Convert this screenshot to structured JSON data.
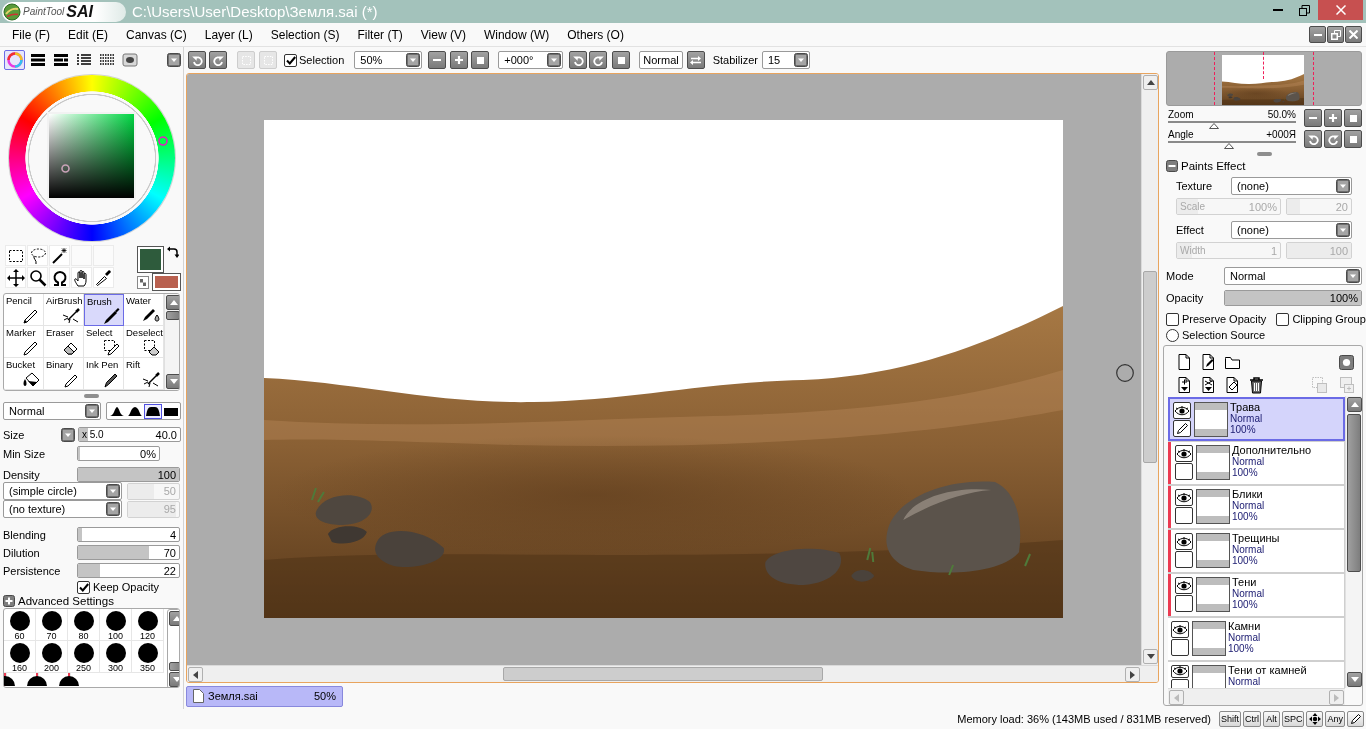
{
  "title_bar": {
    "logo_text": "PaintTool",
    "logo_mark": "SAI",
    "title": "C:\\Users\\User\\Desktop\\Земля.sai (*)"
  },
  "menu": [
    "File (F)",
    "Edit (E)",
    "Canvas (C)",
    "Layer (L)",
    "Selection (S)",
    "Filter (T)",
    "View (V)",
    "Window (W)",
    "Others (O)"
  ],
  "color_modes": [
    {
      "selected": true
    },
    {
      "selected": false
    },
    {
      "selected": false
    },
    {
      "selected": false
    },
    {
      "selected": false
    },
    {
      "selected": false
    }
  ],
  "swatches": [
    {
      "color": "#2e5b3c"
    },
    {
      "color": "#b9604f"
    }
  ],
  "tools": [
    {
      "name": "Pencil",
      "selected": false
    },
    {
      "name": "AirBrush",
      "selected": false
    },
    {
      "name": "Brush",
      "selected": true
    },
    {
      "name": "Water",
      "selected": false
    },
    {
      "name": "Marker",
      "selected": false
    },
    {
      "name": "Eraser",
      "selected": false
    },
    {
      "name": "Select",
      "selected": false
    },
    {
      "name": "Deselect",
      "selected": false
    },
    {
      "name": "Bucket",
      "selected": false
    },
    {
      "name": "Binary",
      "selected": false
    },
    {
      "name": "Ink Pen",
      "selected": false
    },
    {
      "name": "Rift",
      "selected": false
    }
  ],
  "brush": {
    "mode": "Normal",
    "shapes": [
      {
        "selected": false
      },
      {
        "selected": false
      },
      {
        "selected": true
      },
      {
        "selected": false
      }
    ],
    "size": {
      "label": "Size",
      "multiplier": "x 5.0",
      "value": "40.0",
      "level": 0.09
    },
    "min_size": {
      "label": "Min Size",
      "value": "0%",
      "level": 0
    },
    "density": {
      "label": "Density",
      "value": "100",
      "level": 1
    },
    "shape": {
      "value": "(simple circle)",
      "strength": "50",
      "level": 0.5,
      "disabled": true
    },
    "texture": {
      "value": "(no texture)",
      "strength": "95",
      "level": 0.95,
      "disabled": true
    },
    "sliders": [
      {
        "label": "Blending",
        "value": "4",
        "level": 0.04
      },
      {
        "label": "Dilution",
        "value": "70",
        "level": 0.7
      },
      {
        "label": "Persistence",
        "value": "22",
        "level": 0.22
      }
    ],
    "keep_opacity": {
      "label": "Keep Opacity",
      "checked": true
    },
    "advanced": {
      "label": "Advanced Settings",
      "expanded": false
    },
    "presets": [
      {
        "label": "60"
      },
      {
        "label": "70"
      },
      {
        "label": "80"
      },
      {
        "label": "100"
      },
      {
        "label": "120"
      },
      {
        "label": "160"
      },
      {
        "label": "200"
      },
      {
        "label": "250"
      },
      {
        "label": "300"
      },
      {
        "label": "350"
      },
      {
        "kind": "clipped"
      },
      {
        "kind": "clipped"
      },
      {
        "kind": "clipped"
      }
    ]
  },
  "canvas_toolbar": {
    "selection_buttons": [
      {
        "disabled": true
      },
      {
        "disabled": true
      }
    ],
    "selection": {
      "label": "Selection",
      "checked": true
    },
    "zoom": "50%",
    "angle": "+000°",
    "mode": "Normal",
    "stabilizer_label": "Stabilizer",
    "stabilizer": "15"
  },
  "document_tabs": [
    {
      "name": "Земля.sai",
      "zoom": "50%",
      "selected": true
    }
  ],
  "navigator": {
    "zoom": {
      "label": "Zoom",
      "value": "50.0%",
      "level": 0.36
    },
    "angle": {
      "label": "Angle",
      "value": "+000Я",
      "level": 0.48
    }
  },
  "paints_effect": {
    "title": "Paints Effect",
    "expanded": true,
    "rows": [
      {
        "label": "Texture",
        "value": "(none)",
        "fields": [
          {
            "label": "Scale",
            "value": "100%",
            "level": 0.2,
            "disabled": true
          },
          {
            "value": "20",
            "level": 0.2,
            "disabled": true
          }
        ]
      },
      {
        "label": "Effect",
        "value": "(none)",
        "fields": [
          {
            "label": "Width",
            "value": "1",
            "level": 0.15,
            "disabled": true
          },
          {
            "value": "100",
            "level": 1,
            "disabled": true
          }
        ]
      }
    ]
  },
  "layer_props": {
    "mode_label": "Mode",
    "mode": "Normal",
    "opacity": {
      "label": "Opacity",
      "value": "100%",
      "level": 1
    },
    "preserve_opacity": {
      "label": "Preserve Opacity",
      "checked": false
    },
    "clipping_group": {
      "label": "Clipping Group",
      "checked": false
    },
    "selection_source": {
      "label": "Selection Source",
      "selected": false
    }
  },
  "layer_tools": [
    {
      "disabled": false
    },
    {
      "disabled": false
    },
    {
      "disabled": false
    },
    {
      "disabled": false
    },
    {
      "disabled": false
    },
    {
      "disabled": false
    },
    {
      "disabled": false
    },
    {
      "disabled": false
    },
    {
      "disabled": true
    },
    {
      "disabled": true
    }
  ],
  "layers": [
    {
      "name": "Трава",
      "mode": "Normal",
      "opacity": "100%",
      "selected": true,
      "visible": true,
      "clipping": false
    },
    {
      "name": "Дополнительно",
      "mode": "Normal",
      "opacity": "100%",
      "selected": false,
      "visible": true,
      "clipping": true
    },
    {
      "name": "Блики",
      "mode": "Normal",
      "opacity": "100%",
      "selected": false,
      "visible": true,
      "clipping": true
    },
    {
      "name": "Трещины",
      "mode": "Normal",
      "opacity": "100%",
      "selected": false,
      "visible": true,
      "clipping": true
    },
    {
      "name": "Тени",
      "mode": "Normal",
      "opacity": "100%",
      "selected": false,
      "visible": true,
      "clipping": true
    },
    {
      "name": "Камни",
      "mode": "Normal",
      "opacity": "100%",
      "selected": false,
      "visible": true,
      "clipping": false
    },
    {
      "name": "Тени от камней",
      "mode": "Normal",
      "selected": false,
      "visible": true,
      "clipping": false
    }
  ],
  "status_bar": {
    "memory": "Memory load: 36% (143MB used / 831MB reserved)",
    "keys": [
      "Shift",
      "Ctrl",
      "Alt",
      "SPC"
    ],
    "any_key": "Any"
  }
}
